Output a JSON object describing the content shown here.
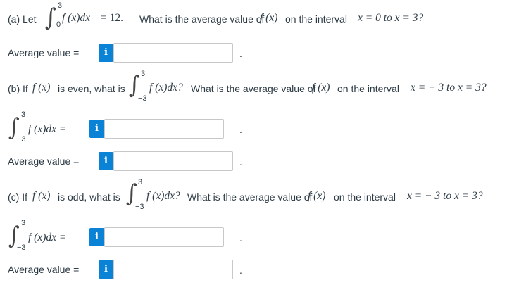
{
  "part_a": {
    "label": "(a) Let",
    "integral": {
      "lower": "0",
      "upper": "3",
      "integrand": "f (x)dx",
      "rhs": "= 12."
    },
    "question": "What is the average value of",
    "fx": "f (x)",
    "on_interval": "on the interval",
    "interval": "x = 0 to x = 3?",
    "answer_label": "Average value  =",
    "answer_value": "",
    "period": "."
  },
  "part_b": {
    "label": "(b) If",
    "fx": "f (x)",
    "condition": "is even, what is",
    "integral": {
      "lower": "−3",
      "upper": "3",
      "integrand": "f (x)dx?"
    },
    "question": "What is the average value of",
    "on_interval": "on the interval",
    "interval": "x = − 3 to x = 3?",
    "integral_answer": {
      "lower": "−3",
      "upper": "3",
      "integrand": "f (x)dx  =",
      "value": ""
    },
    "answer_label": "Average value  =",
    "answer_value": "",
    "period": "."
  },
  "part_c": {
    "label": "(c) If",
    "fx": "f (x)",
    "condition": "is odd, what is",
    "integral": {
      "lower": "−3",
      "upper": "3",
      "integrand": "f (x)dx?"
    },
    "question": "What is the average value of",
    "on_interval": "on the interval",
    "interval": "x = − 3 to x = 3?",
    "integral_answer": {
      "lower": "−3",
      "upper": "3",
      "integrand": "f (x)dx  =",
      "value": ""
    },
    "answer_label": "Average value  =",
    "answer_value": "",
    "period": "."
  },
  "info_icon": {
    "symbol": "i",
    "color": "#0a82d6"
  }
}
